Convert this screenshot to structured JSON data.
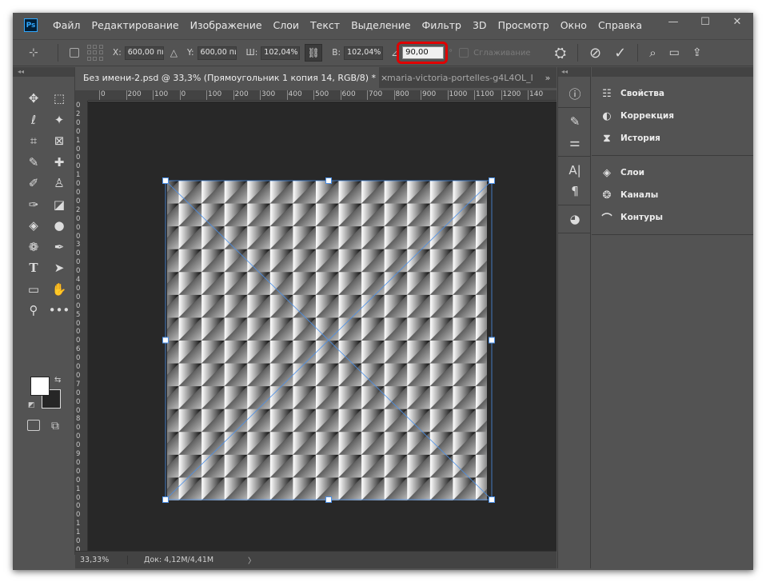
{
  "app": {
    "logo": "Ps",
    "colors": {
      "window": "#535353",
      "canvas": "#282828",
      "highlight": "#e00000",
      "handle": "#4a8fe8"
    }
  },
  "menu": [
    "Файл",
    "Редактирование",
    "Изображение",
    "Слои",
    "Текст",
    "Выделение",
    "Фильтр",
    "3D",
    "Просмотр",
    "Окно",
    "Справка"
  ],
  "window_controls": {
    "minimize": "—",
    "maximize": "☐",
    "close": "✕"
  },
  "options": {
    "x_label": "X:",
    "x_value": "600,00 пи",
    "y_label": "Y:",
    "y_value": "600,00 пи",
    "w_label": "Ш:",
    "w_value": "102,04%",
    "h_label": "В:",
    "h_value": "102,04%",
    "rotate_value": "90,00",
    "rotate_unit": "°",
    "smoothing_label": "Сглаживание"
  },
  "tabs": [
    {
      "label": "Без имени-2.psd @ 33,3% (Прямоугольник 1 копия 14, RGB/8) *",
      "close": "×"
    },
    {
      "label": "maria-victoria-portelles-g4L4OL_l"
    }
  ],
  "tabs_more": "»",
  "ruler": {
    "top": [
      "0",
      "200",
      "100",
      "0",
      "100",
      "200",
      "300",
      "400",
      "500",
      "600",
      "700",
      "800",
      "900",
      "1000",
      "1100",
      "1200",
      "140"
    ],
    "left": [
      "0",
      "2",
      "0",
      "0",
      "1",
      "0",
      "0",
      "0",
      "1",
      "0",
      "0",
      "0",
      "2",
      "0",
      "0",
      "0",
      "3",
      "0",
      "0",
      "0",
      "4",
      "0",
      "0",
      "0",
      "5",
      "0",
      "0",
      "0",
      "6",
      "0",
      "0",
      "0",
      "7",
      "0",
      "0",
      "0",
      "8",
      "0",
      "0",
      "0",
      "9",
      "0",
      "0",
      "0",
      "1",
      "0",
      "0",
      "0",
      "1",
      "1",
      "0",
      "0"
    ]
  },
  "status": {
    "zoom": "33,33%",
    "doc": "Док: 4,12M/4,41M",
    "arrow": "〉"
  },
  "panels": {
    "group1": [
      {
        "label": "Свойства",
        "icon": "properties-icon"
      },
      {
        "label": "Коррекция",
        "icon": "adjustments-icon"
      },
      {
        "label": "История",
        "icon": "history-icon"
      }
    ],
    "group2": [
      {
        "label": "Слои",
        "icon": "layers-icon"
      },
      {
        "label": "Каналы",
        "icon": "channels-icon"
      },
      {
        "label": "Контуры",
        "icon": "paths-icon"
      }
    ]
  },
  "pattern": {
    "rows": 14,
    "cols": 14
  }
}
